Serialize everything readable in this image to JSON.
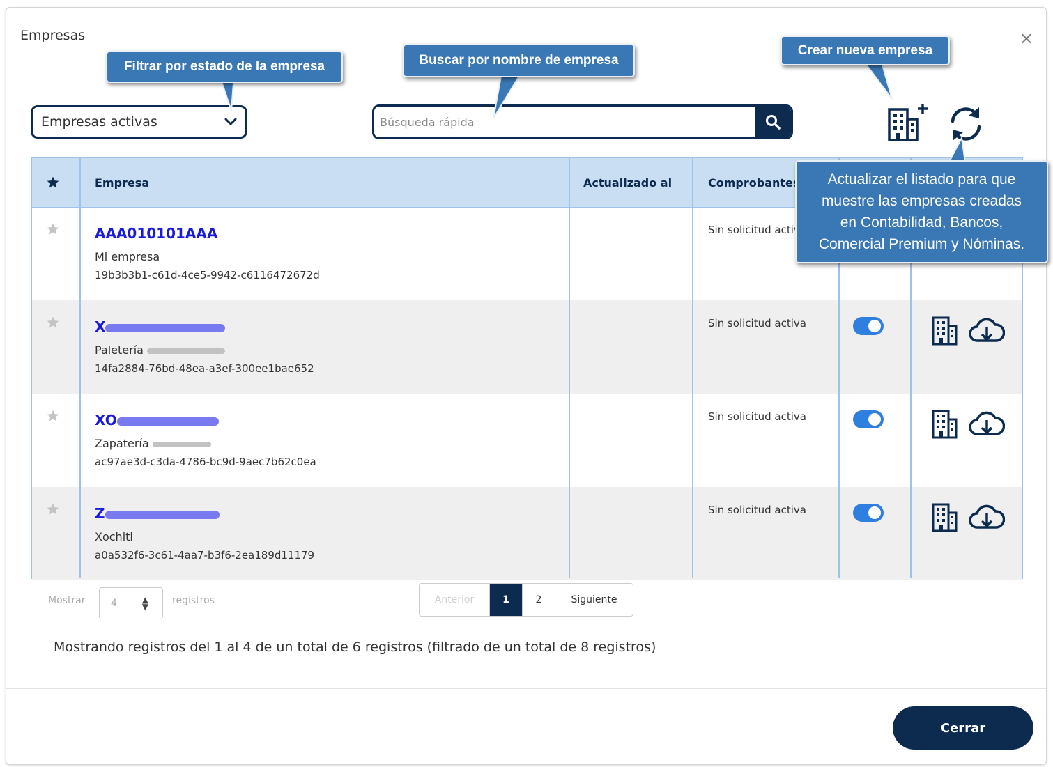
{
  "modal": {
    "title": "Empresas",
    "close_symbol": "×"
  },
  "filter": {
    "selected": "Empresas activas"
  },
  "search": {
    "placeholder": "Búsqueda rápida"
  },
  "table": {
    "headers": {
      "empresa": "Empresa",
      "actualizado": "Actualizado al",
      "comprobantes": "Comprobantes"
    },
    "rows": [
      {
        "code": "AAA010101AAA",
        "name": "Mi empresa",
        "uuid": "19b3b3b1-c61d-4ce5-9942-c6116472672d",
        "status": "Sin solicitud activa",
        "redacted": false
      },
      {
        "code": "X",
        "name": "Paletería",
        "uuid": "14fa2884-76bd-48ea-a3ef-300ee1bae652",
        "status": "Sin solicitud activa",
        "redacted": true,
        "toggle_on": true
      },
      {
        "code": "XO",
        "name": "Zapatería",
        "uuid": "ac97ae3d-c3da-4786-bc9d-9aec7b62c0ea",
        "status": "Sin solicitud activa",
        "redacted": true,
        "toggle_on": true
      },
      {
        "code": "Z",
        "name": "Xochitl",
        "uuid": "a0a532f6-3c61-4aa7-b3f6-2ea189d11179",
        "status": "Sin solicitud activa",
        "redacted": true,
        "toggle_on": true
      }
    ]
  },
  "paging": {
    "show_label": "Mostrar",
    "page_size": "4",
    "records_label": "registros",
    "prev": "Anterior",
    "pages": [
      "1",
      "2"
    ],
    "current_page": "1",
    "next": "Siguiente"
  },
  "summary": "Mostrando registros del 1 al 4 de un total de 6 registros (filtrado de un total de 8 registros)",
  "footer": {
    "close_button": "Cerrar"
  },
  "callouts": {
    "filter": "Filtrar por estado de la empresa",
    "search": "Buscar por nombre de empresa",
    "create": "Crear nueva empresa",
    "refresh_lines": [
      "Actualizar el listado para que",
      "muestre las empresas creadas",
      "en Contabilidad, Bancos,",
      "Comercial Premium y Nóminas."
    ]
  },
  "colors": {
    "navy": "#0d2a4f",
    "header_bg": "#c9def2",
    "link_blue": "#1a1adc",
    "callout_blue": "#3a78b5",
    "toggle_blue": "#2f7fe0"
  },
  "icons": [
    "star-icon",
    "search-icon",
    "building-add-icon",
    "refresh-icon",
    "building-icon",
    "cloud-download-icon",
    "chevron-down-icon",
    "close-icon"
  ]
}
